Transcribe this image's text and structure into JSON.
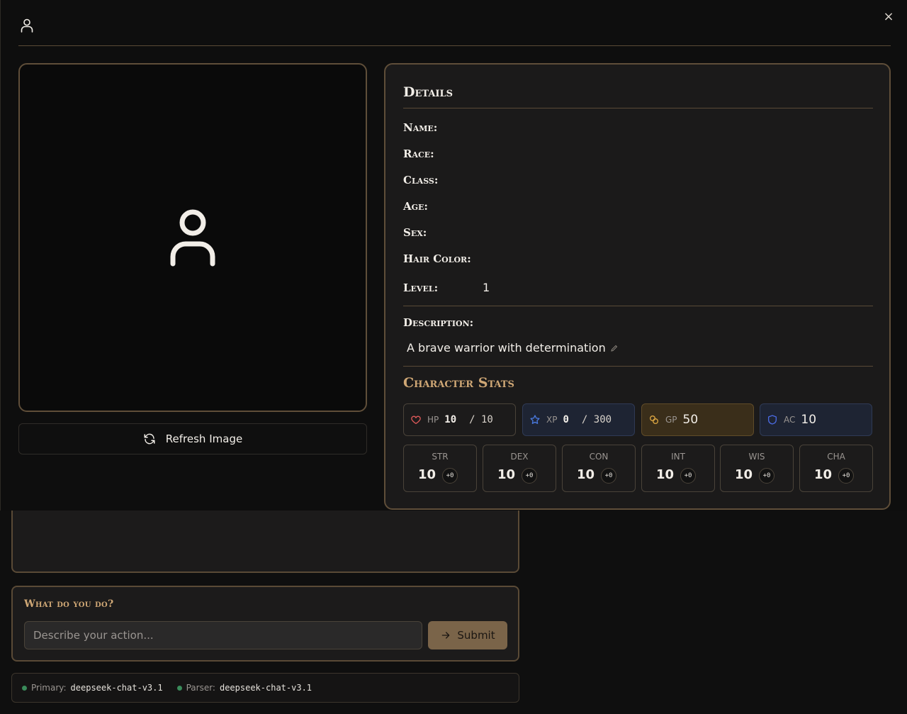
{
  "modal": {
    "close_symbol": "×",
    "header_icon": "user-icon",
    "refresh_label": "Refresh Image",
    "details_title": "Details",
    "fields": [
      {
        "label": "Name:",
        "value": ""
      },
      {
        "label": "Race:",
        "value": ""
      },
      {
        "label": "Class:",
        "value": ""
      },
      {
        "label": "Age:",
        "value": ""
      },
      {
        "label": "Sex:",
        "value": ""
      },
      {
        "label": "Hair Color:",
        "value": ""
      },
      {
        "label": "Level:",
        "value": "1"
      }
    ],
    "description_label": "Description:",
    "description_text": "A brave warrior with determination",
    "stats_title": "Character Stats",
    "hp": {
      "label": "HP",
      "current": "10",
      "max": "/ 10",
      "color": "#e05a5a"
    },
    "xp": {
      "label": "XP",
      "current": "0",
      "max": "/ 300",
      "color": "#4a7ae0"
    },
    "gp": {
      "label": "GP",
      "value": "50",
      "color": "#d9a441"
    },
    "ac": {
      "label": "AC",
      "value": "10",
      "color": "#4a6ae0"
    },
    "abilities": [
      {
        "name": "STR",
        "score": "10",
        "mod": "+0"
      },
      {
        "name": "DEX",
        "score": "10",
        "mod": "+0"
      },
      {
        "name": "CON",
        "score": "10",
        "mod": "+0"
      },
      {
        "name": "INT",
        "score": "10",
        "mod": "+0"
      },
      {
        "name": "WIS",
        "score": "10",
        "mod": "+0"
      },
      {
        "name": "CHA",
        "score": "10",
        "mod": "+0"
      }
    ]
  },
  "action": {
    "title": "What do you do?",
    "placeholder": "Describe your action...",
    "submit_label": "Submit"
  },
  "status": {
    "primary_label": "Primary:",
    "primary_value": "deepseek-chat-v3.1",
    "parser_label": "Parser:",
    "parser_value": "deepseek-chat-v3.1",
    "dot_color": "#3a8b5a"
  },
  "colors": {
    "accent": "#cfa775",
    "border": "#5f4e39"
  }
}
